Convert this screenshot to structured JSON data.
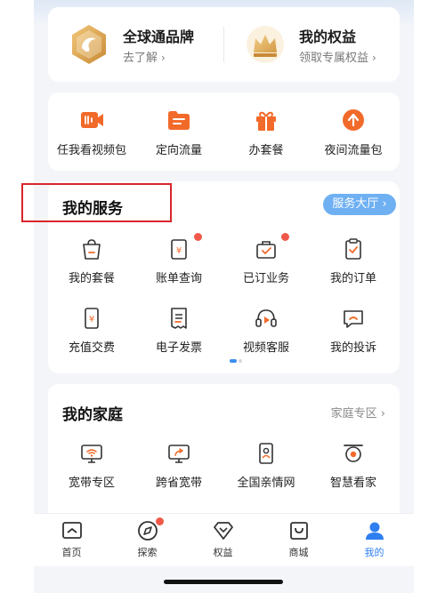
{
  "brand_card": {
    "left": {
      "title": "全球通品牌",
      "subtitle": "去了解",
      "icon": "globe-brand-icon"
    },
    "right": {
      "title": "我的权益",
      "subtitle": "领取专属权益",
      "icon": "crown-icon"
    }
  },
  "quick_actions": [
    {
      "label": "任我看视频包",
      "icon": "video-package-icon"
    },
    {
      "label": "定向流量",
      "icon": "folder-traffic-icon"
    },
    {
      "label": "办套餐",
      "icon": "gift-icon"
    },
    {
      "label": "夜间流量包",
      "icon": "upload-arrow-icon"
    }
  ],
  "services": {
    "title": "我的服务",
    "hall_button": "服务大厅",
    "items": [
      {
        "label": "我的套餐",
        "icon": "bag-icon",
        "badge": false
      },
      {
        "label": "账单查询",
        "icon": "bill-icon",
        "badge": true
      },
      {
        "label": "已订业务",
        "icon": "briefcase-icon",
        "badge": true
      },
      {
        "label": "我的订单",
        "icon": "clipboard-check-icon",
        "badge": false
      },
      {
        "label": "充值交费",
        "icon": "phone-yuan-icon",
        "badge": false
      },
      {
        "label": "电子发票",
        "icon": "invoice-icon",
        "badge": false
      },
      {
        "label": "视频客服",
        "icon": "headset-icon",
        "badge": false
      },
      {
        "label": "我的投诉",
        "icon": "complaint-icon",
        "badge": false
      }
    ]
  },
  "family": {
    "title": "我的家庭",
    "more": "家庭专区",
    "items": [
      {
        "label": "宽带专区",
        "icon": "wifi-monitor-icon"
      },
      {
        "label": "跨省宽带",
        "icon": "share-monitor-icon"
      },
      {
        "label": "全国亲情网",
        "icon": "phone-person-icon"
      },
      {
        "label": "智慧看家",
        "icon": "camera-icon"
      }
    ]
  },
  "tabbar": [
    {
      "label": "首页",
      "icon": "home-icon",
      "active": false,
      "badge": false
    },
    {
      "label": "探索",
      "icon": "compass-icon",
      "active": false,
      "badge": true
    },
    {
      "label": "权益",
      "icon": "diamond-icon",
      "active": false,
      "badge": false
    },
    {
      "label": "商城",
      "icon": "shopping-bag-icon",
      "active": false,
      "badge": false
    },
    {
      "label": "我的",
      "icon": "user-icon",
      "active": true,
      "badge": false
    }
  ],
  "colors": {
    "accent_blue": "#2f7ff0",
    "orange": "#f26a2a",
    "badge_red": "#f0594a",
    "highlight_red": "#d9252b",
    "gold": "#d9a24a"
  }
}
